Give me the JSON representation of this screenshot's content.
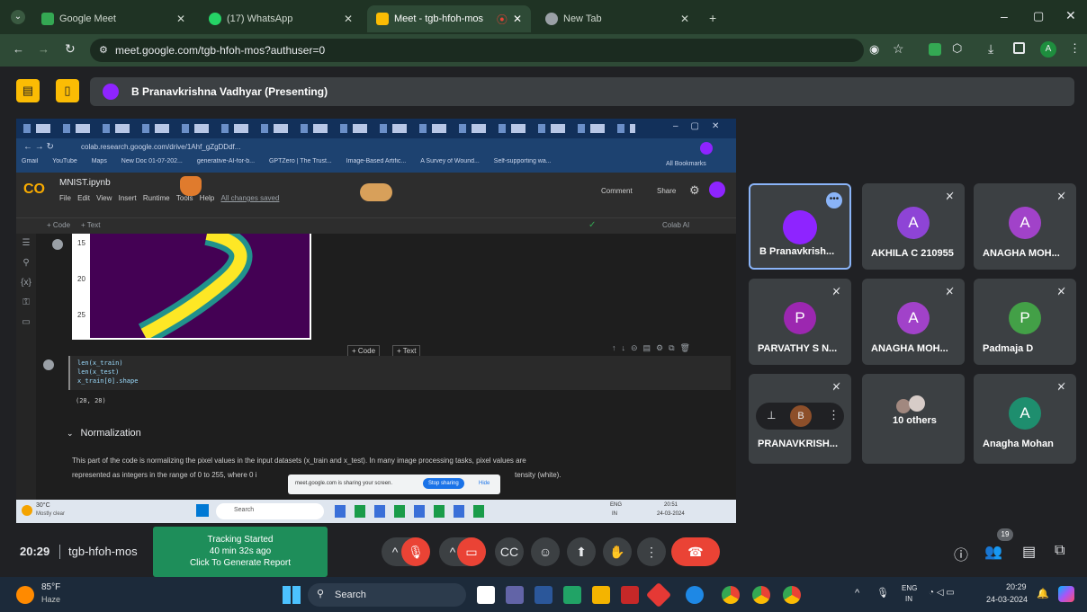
{
  "browser": {
    "tabs": [
      {
        "label": "Google Meet",
        "color": "#34a853"
      },
      {
        "label": "(17) WhatsApp",
        "color": "#25d366"
      },
      {
        "label": "Meet - tgb-hfoh-mos",
        "color": "#fbbc04"
      },
      {
        "label": "New Tab",
        "color": "#9aa0a6"
      }
    ],
    "url": "meet.google.com/tgb-hfoh-mos?authuser=0",
    "profile_initial": "A"
  },
  "presenter": {
    "label": "B Pranavkrishna Vadhyar (Presenting)"
  },
  "shared": {
    "colab_url": "colab.research.google.com/drive/1Ahf_gZgDDdf...",
    "bookmarks": [
      "Gmail",
      "YouTube",
      "Maps",
      "New Doc 01-07-202...",
      "generative-AI-for-b...",
      "GPTZero | The Trust...",
      "Image-Based Artific...",
      "A Survey of Wound...",
      "Self-supporting wa..."
    ],
    "all_bookmarks": "All Bookmarks",
    "notebook_title": "MNIST.ipynb",
    "menu": [
      "File",
      "Edit",
      "View",
      "Insert",
      "Runtime",
      "Tools",
      "Help"
    ],
    "changes_saved": "All changes saved",
    "add_code": "+ Code",
    "add_text": "+ Text",
    "comment": "Comment",
    "share": "Share",
    "gemini": "Colab AI",
    "y_ticks": [
      "15",
      "20",
      "25"
    ],
    "cell_code": [
      "len(x_train)",
      "len(x_test)",
      "x_train[0].shape"
    ],
    "cell_output": "(28, 28)",
    "section_title": "Normalization",
    "para_line1": "This part of the code is normalizing the pixel values in the input datasets (x_train and x_test). In many image processing tasks, pixel values are",
    "para_line2": "represented as integers in the range of 0 to 255, where 0 i",
    "para_line2_end": "tensity (white).",
    "sharing_notice": "meet.google.com is sharing your screen.",
    "stop_sharing": "Stop sharing",
    "hide": "Hide",
    "weather_temp": "30°C",
    "weather_cond": "Mostly clear",
    "search": "Search",
    "lang": "ENG",
    "region": "IN",
    "time": "20:51",
    "date": "24-03-2024"
  },
  "participants": [
    {
      "name": "B Pranavkrish...",
      "initial": "",
      "color": "#8e24ff",
      "highlight": true
    },
    {
      "name": "AKHILA C 210955",
      "initial": "A",
      "color": "#8e44d6"
    },
    {
      "name": "ANAGHA MOH...",
      "initial": "A",
      "color": "#a142c9"
    },
    {
      "name": "PARVATHY S N...",
      "initial": "P",
      "color": "#9c27b0"
    },
    {
      "name": "ANAGHA MOH...",
      "initial": "A",
      "color": "#a142c9"
    },
    {
      "name": "Padmaja D",
      "initial": "P",
      "color": "#43a047"
    },
    {
      "name": "PRANAVKRISH...",
      "initial": "B",
      "color": "#8d4f2a"
    },
    {
      "name": "10 others",
      "initial": "",
      "color": "#3c4043"
    },
    {
      "name": "Anagha Mohan",
      "initial": "A",
      "color": "#1e8e6e"
    }
  ],
  "meeting": {
    "time": "20:29",
    "code": "tgb-hfoh-mos",
    "participant_count": "19"
  },
  "tracking": {
    "line1": "Tracking Started",
    "line2": "40 min 32s ago",
    "line3": "Click To Generate Report"
  },
  "taskbar": {
    "temp": "85°F",
    "cond": "Haze",
    "search": "Search",
    "lang": "ENG",
    "region": "IN",
    "time": "20:29",
    "date": "24-03-2024"
  }
}
